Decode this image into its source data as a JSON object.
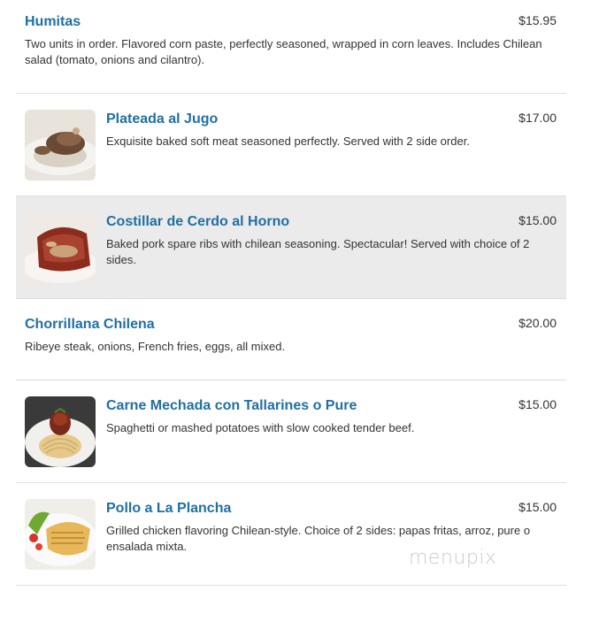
{
  "menu": {
    "items": [
      {
        "name": "Humitas",
        "price": "$15.95",
        "description": "Two units in order. Flavored corn paste, perfectly seasoned, wrapped in corn leaves. Includes Chilean salad (tomato, onions and cilantro).",
        "has_image": false,
        "highlighted": false
      },
      {
        "name": "Plateada al Jugo",
        "price": "$17.00",
        "description": "Exquisite baked soft meat seasoned perfectly. Served with 2 side order.",
        "has_image": true,
        "highlighted": false
      },
      {
        "name": "Costillar de Cerdo al Horno",
        "price": "$15.00",
        "description": "Baked pork spare ribs with chilean seasoning. Spectacular! Served with choice of 2 sides.",
        "has_image": true,
        "highlighted": true
      },
      {
        "name": "Chorrillana Chilena",
        "price": "$20.00",
        "description": "Ribeye steak, onions, French fries, eggs, all mixed.",
        "has_image": false,
        "highlighted": false
      },
      {
        "name": "Carne Mechada con Tallarines o Pure",
        "price": "$15.00",
        "description": "Spaghetti or mashed potatoes with slow cooked tender beef.",
        "has_image": true,
        "highlighted": false
      },
      {
        "name": "Pollo a La Plancha",
        "price": "$15.00",
        "description": "Grilled chicken flavoring Chilean-style. Choice of 2 sides: papas fritas, arroz, pure o ensalada mixta.",
        "has_image": true,
        "highlighted": false
      }
    ]
  },
  "watermark": "menupix",
  "colors": {
    "item_name": "#1f6fa4",
    "highlight_bg": "#ebebeb",
    "divider": "#dddddd",
    "text": "#333333"
  }
}
